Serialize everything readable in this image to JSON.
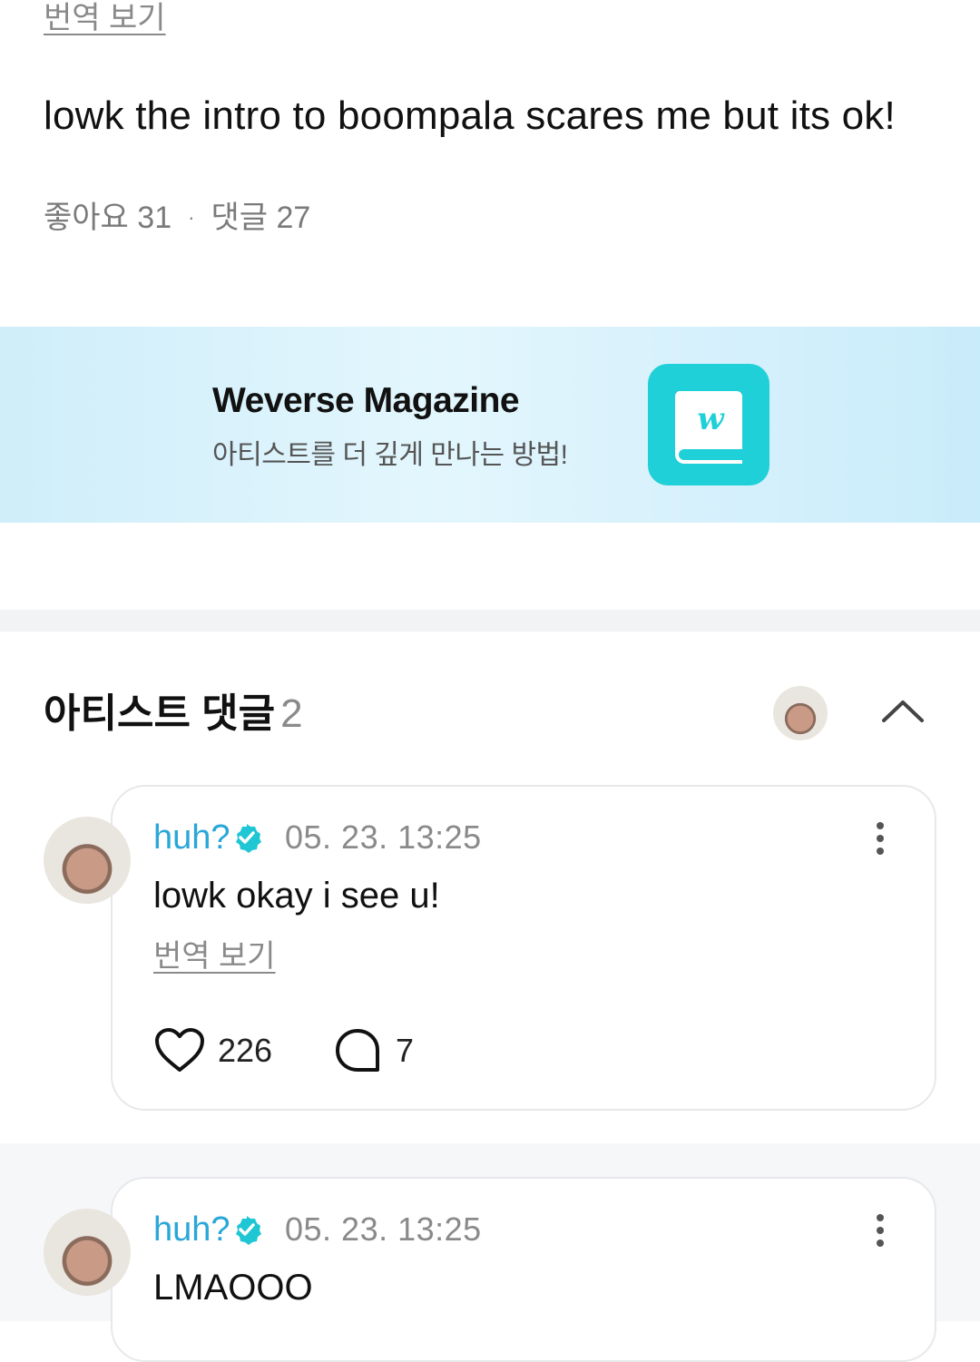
{
  "post": {
    "translate_label": "번역 보기",
    "body": "lowk the intro to boompala scares me but its ok!",
    "likes_label": "좋아요 31",
    "dot": "·",
    "comments_label": "댓글 27"
  },
  "banner": {
    "title": "Weverse Magazine",
    "subtitle": "아티스트를 더 깊게 만나는 방법!",
    "logo_letter": "w",
    "colors": {
      "logo_bg": "#1fd0d8",
      "banner_bg": "#d7f1fc"
    }
  },
  "artist_comments": {
    "title": "아티스트 댓글",
    "count": "2",
    "collapse_icon": "chevron-up-icon"
  },
  "comments": [
    {
      "username": "huh?",
      "verified_icon": "verified-badge-icon",
      "timestamp": "05. 23. 13:25",
      "text": "lowk okay i see u!",
      "translate_label": "번역 보기",
      "likes": "226",
      "replies": "7"
    },
    {
      "username": "huh?",
      "verified_icon": "verified-badge-icon",
      "timestamp": "05. 23. 13:25",
      "text": "LMAOOO"
    }
  ],
  "colors": {
    "accent": "#2aa7d8",
    "badge": "#1fc6d4",
    "muted": "#8a8a8a"
  }
}
